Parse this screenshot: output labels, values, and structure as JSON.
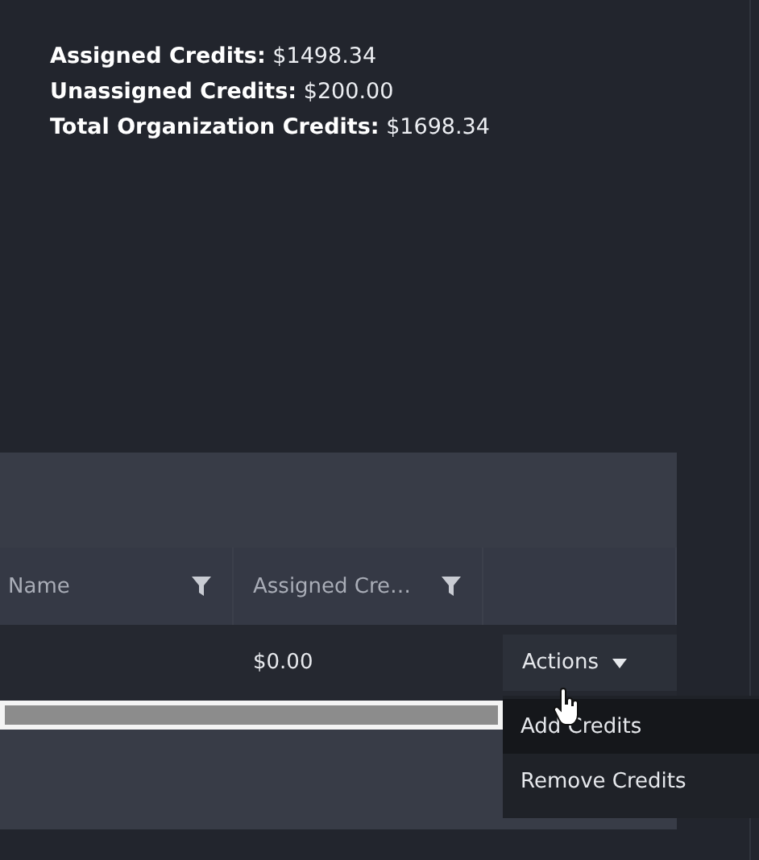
{
  "summary": [
    {
      "label": "Assigned Credits:",
      "value": "$1498.34"
    },
    {
      "label": "Unassigned Credits:",
      "value": "$200.00"
    },
    {
      "label": "Total Organization Credits:",
      "value": "$1698.34"
    }
  ],
  "table": {
    "columns": [
      {
        "label": "Name",
        "filterable": true
      },
      {
        "label": "Assigned Cre…",
        "filterable": true
      }
    ],
    "rows": [
      {
        "assigned_credits": "$0.00",
        "actions_button": "Actions"
      }
    ]
  },
  "actions_menu": {
    "items": [
      {
        "label": "Add Credits",
        "hovered": true
      },
      {
        "label": "Remove Credits",
        "hovered": false
      }
    ]
  }
}
